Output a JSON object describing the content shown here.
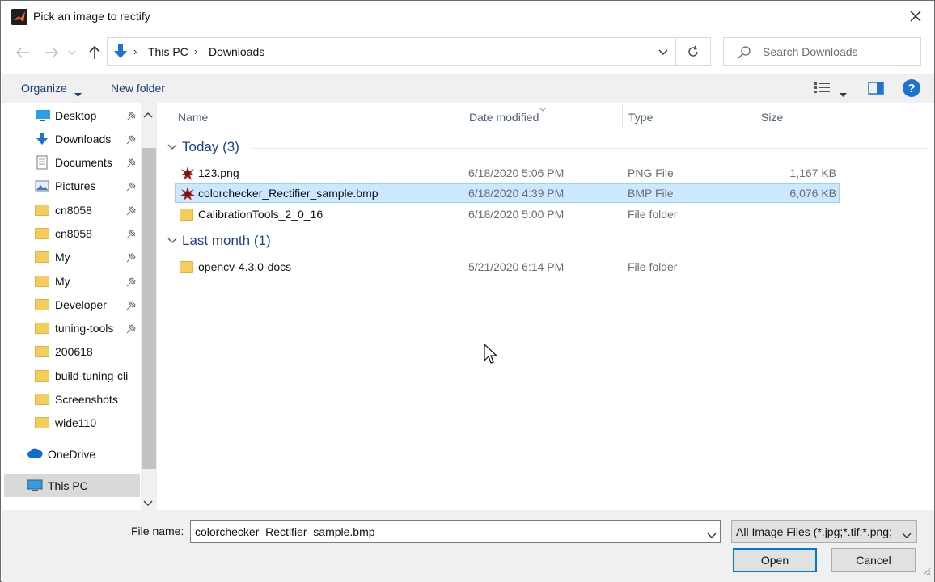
{
  "window": {
    "title": "Pick an image to rectify",
    "close_icon": "close-icon"
  },
  "address": {
    "crumbs": [
      "This PC",
      "Downloads"
    ],
    "search_placeholder": "Search Downloads"
  },
  "toolbar": {
    "organize_label": "Organize",
    "new_folder_label": "New folder",
    "help_label": "?"
  },
  "sidebar": {
    "items": [
      {
        "label": "Desktop",
        "icon": "desktop-icon",
        "pinned": true
      },
      {
        "label": "Downloads",
        "icon": "downloads-icon",
        "pinned": true
      },
      {
        "label": "Documents",
        "icon": "documents-icon",
        "pinned": true
      },
      {
        "label": "Pictures",
        "icon": "pictures-icon",
        "pinned": true
      },
      {
        "label": "cn8058",
        "icon": "folder-icon",
        "pinned": true
      },
      {
        "label": "cn8058",
        "icon": "folder-icon",
        "pinned": true
      },
      {
        "label": "My",
        "icon": "folder-icon",
        "pinned": true
      },
      {
        "label": "My",
        "icon": "folder-icon",
        "pinned": true
      },
      {
        "label": "Developer",
        "icon": "folder-icon",
        "pinned": true
      },
      {
        "label": "tuning-tools",
        "icon": "folder-icon",
        "pinned": true
      },
      {
        "label": "200618",
        "icon": "folder-icon",
        "pinned": false
      },
      {
        "label": "build-tuning-cli",
        "icon": "folder-icon",
        "pinned": false
      },
      {
        "label": "Screenshots",
        "icon": "folder-icon",
        "pinned": false
      },
      {
        "label": "wide110",
        "icon": "folder-icon",
        "pinned": false
      }
    ],
    "onedrive_label": "OneDrive",
    "thispc_label": "This PC"
  },
  "columns": {
    "name": "Name",
    "date": "Date modified",
    "type": "Type",
    "size": "Size"
  },
  "groups": [
    {
      "label": "Today (3)",
      "rows": [
        {
          "name": "123.png",
          "date": "6/18/2020 5:06 PM",
          "type": "PNG File",
          "size": "1,167 KB",
          "icon": "image-file-icon",
          "selected": false
        },
        {
          "name": "colorchecker_Rectifier_sample.bmp",
          "date": "6/18/2020 4:39 PM",
          "type": "BMP File",
          "size": "6,076 KB",
          "icon": "image-file-icon",
          "selected": true
        },
        {
          "name": "CalibrationTools_2_0_16",
          "date": "6/18/2020 5:00 PM",
          "type": "File folder",
          "size": "",
          "icon": "folder-icon",
          "selected": false
        }
      ]
    },
    {
      "label": "Last month (1)",
      "rows": [
        {
          "name": "opencv-4.3.0-docs",
          "date": "5/21/2020 6:14 PM",
          "type": "File folder",
          "size": "",
          "icon": "folder-icon",
          "selected": false
        }
      ]
    }
  ],
  "footer": {
    "file_name_label": "File name:",
    "file_name_value": "colorchecker_Rectifier_sample.bmp",
    "filter_value": "All Image Files (*.jpg;*.tif;*.png;",
    "open_label": "Open",
    "cancel_label": "Cancel"
  },
  "colors": {
    "selection_bg": "#cce8ff",
    "selection_border": "#99d1ff",
    "group_text": "#1e3f8a",
    "link_text": "#1b3f75",
    "accent": "#0078d7"
  }
}
